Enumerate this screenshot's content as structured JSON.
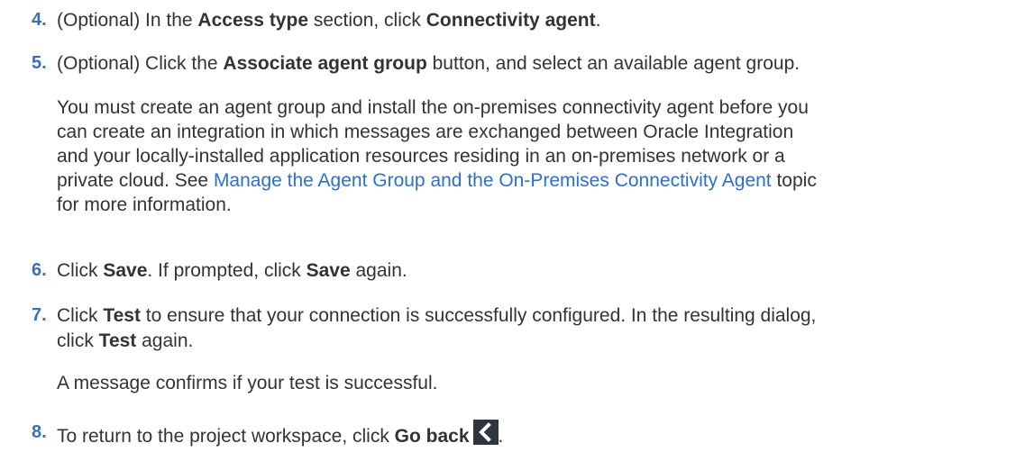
{
  "steps": [
    {
      "num": "4.",
      "pre": "(Optional) In the ",
      "b1": "Access type",
      "mid": " section, click ",
      "b2": "Connectivity agent",
      "post": "."
    },
    {
      "num": "5.",
      "pre": "(Optional) Click the ",
      "b1": "Associate agent group",
      "post": " button, and select an available agent group."
    },
    {
      "num": "6.",
      "pre": "Click ",
      "b1": "Save",
      "mid": ". If prompted, click ",
      "b2": "Save",
      "post": " again."
    },
    {
      "num": "7.",
      "pre": "Click ",
      "b1": "Test",
      "post": " to ensure that your connection is successfully configured. In the resulting dialog,",
      "line2_pre": "click ",
      "line2_b": "Test",
      "line2_post": " again."
    },
    {
      "num": "8.",
      "pre": "To return to the project workspace, click ",
      "b1": "Go back",
      "post": "."
    }
  ],
  "agent_para": {
    "line1": "You must create an agent group and install the on-premises connectivity agent before you",
    "line2": "can create an integration in which messages are exchanged between Oracle Integration",
    "line3": "and your locally-installed application resources residing in an on-premises network or a",
    "line4_pre": "private cloud. See ",
    "line4_link": "Manage the Agent Group and the On-Premises Connectivity Agent",
    "line4_post": " topic",
    "line5": "for more information."
  },
  "test_result_para": "A message confirms if your test is successful.",
  "icons": {
    "go_back": "chevron-left-icon"
  },
  "colors": {
    "step_number": "#3a6fb0",
    "link": "#2f6fc4",
    "icon_bg": "#2f3640"
  }
}
